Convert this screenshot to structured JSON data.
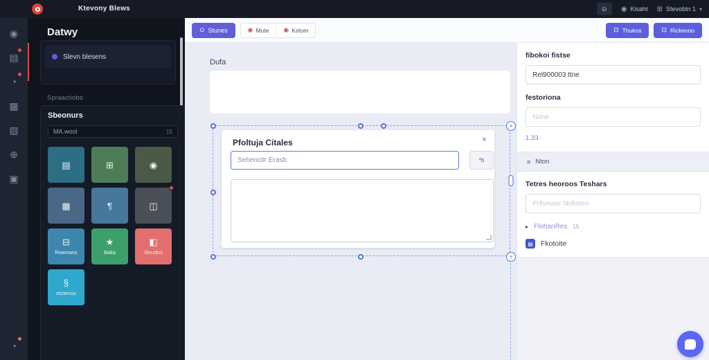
{
  "topbar": {
    "app_title": "Ktevony Blews",
    "grid_button_icon": "⊙",
    "user_icon": "◉",
    "user_label": "Kisaht",
    "team_icon": "⊞",
    "team_label": "Stevobtn 1",
    "chevron": "▾"
  },
  "icon_rail": {
    "items": [
      {
        "glyph": "◉",
        "badge": false
      },
      {
        "glyph": "▤",
        "badge": true
      },
      {
        "glyph": "◔",
        "badge": true
      },
      {
        "glyph": "▦",
        "badge": false
      },
      {
        "glyph": "▧",
        "badge": false
      },
      {
        "glyph": "⊕",
        "badge": false
      },
      {
        "glyph": "▣",
        "badge": false
      }
    ],
    "bottom_item": {
      "glyph": "◔",
      "badge": true
    }
  },
  "sidebar": {
    "title": "Datwy",
    "selected_item": "Slevn blesens",
    "section_label": "Spraactiobo",
    "panel_title": "Sbeonurs",
    "search": {
      "value": "MA.wool",
      "hint": "15"
    },
    "tiles": [
      {
        "icon": "▤",
        "label": "",
        "color": "#2d6e84"
      },
      {
        "icon": "⊞",
        "label": "",
        "color": "#4e7c57"
      },
      {
        "icon": "◉",
        "label": "",
        "color": "#4b5a46"
      },
      {
        "icon": "▦",
        "label": "",
        "color": "#4b6787"
      },
      {
        "icon": "¶",
        "label": "",
        "color": "#47789b"
      },
      {
        "icon": "◫",
        "label": "",
        "color": "#4a4f58",
        "badge": true
      },
      {
        "icon": "⊟",
        "label": "Roamans",
        "color": "#3d87ae"
      },
      {
        "icon": "★",
        "label": "Baita",
        "color": "#3da06a"
      },
      {
        "icon": "◧",
        "label": "Sloudus",
        "color": "#e26f6e"
      },
      {
        "icon": "§",
        "label": "etctenus",
        "color": "#2fa8ce"
      }
    ]
  },
  "toolbar": {
    "tabs": [
      {
        "icon": "⊙",
        "label": "Stunes"
      },
      {
        "icon": "◉",
        "label": "Mute"
      },
      {
        "icon": "◉",
        "label": "Kstom"
      }
    ],
    "actions": [
      {
        "icon": "⊡",
        "label": "Thukos"
      },
      {
        "icon": "⊡",
        "label": "Rickevoo"
      }
    ]
  },
  "canvas": {
    "page_label": "Dufa",
    "card": {
      "title": "Pfoltuja Citales",
      "menu_icon": "≡",
      "input_placeholder": "Sehenctir Erasb",
      "side_button": "*b"
    }
  },
  "inspector": {
    "field1_label": "fibokoi fistse",
    "field1_value": "Rel900003 ttne",
    "field2_label": "festoriona",
    "field2_placeholder": "None",
    "link_label": "1.33.",
    "toggle_icon": "≡",
    "toggle_label": "Nton",
    "section2_label": "Tetres heoroos Teshars",
    "field3_placeholder": "Prfivnowr Nokoteo",
    "row1_icon": "▸",
    "row1_label": "FlohanRes",
    "row1_badge": "15",
    "row2_icon": "▤",
    "row2_label": "Fkotoite"
  },
  "colors": {
    "accent": "#5b5fdd",
    "selection": "#4f72e0",
    "danger_dot": "#e0524e",
    "chat": "#5a67f2"
  }
}
